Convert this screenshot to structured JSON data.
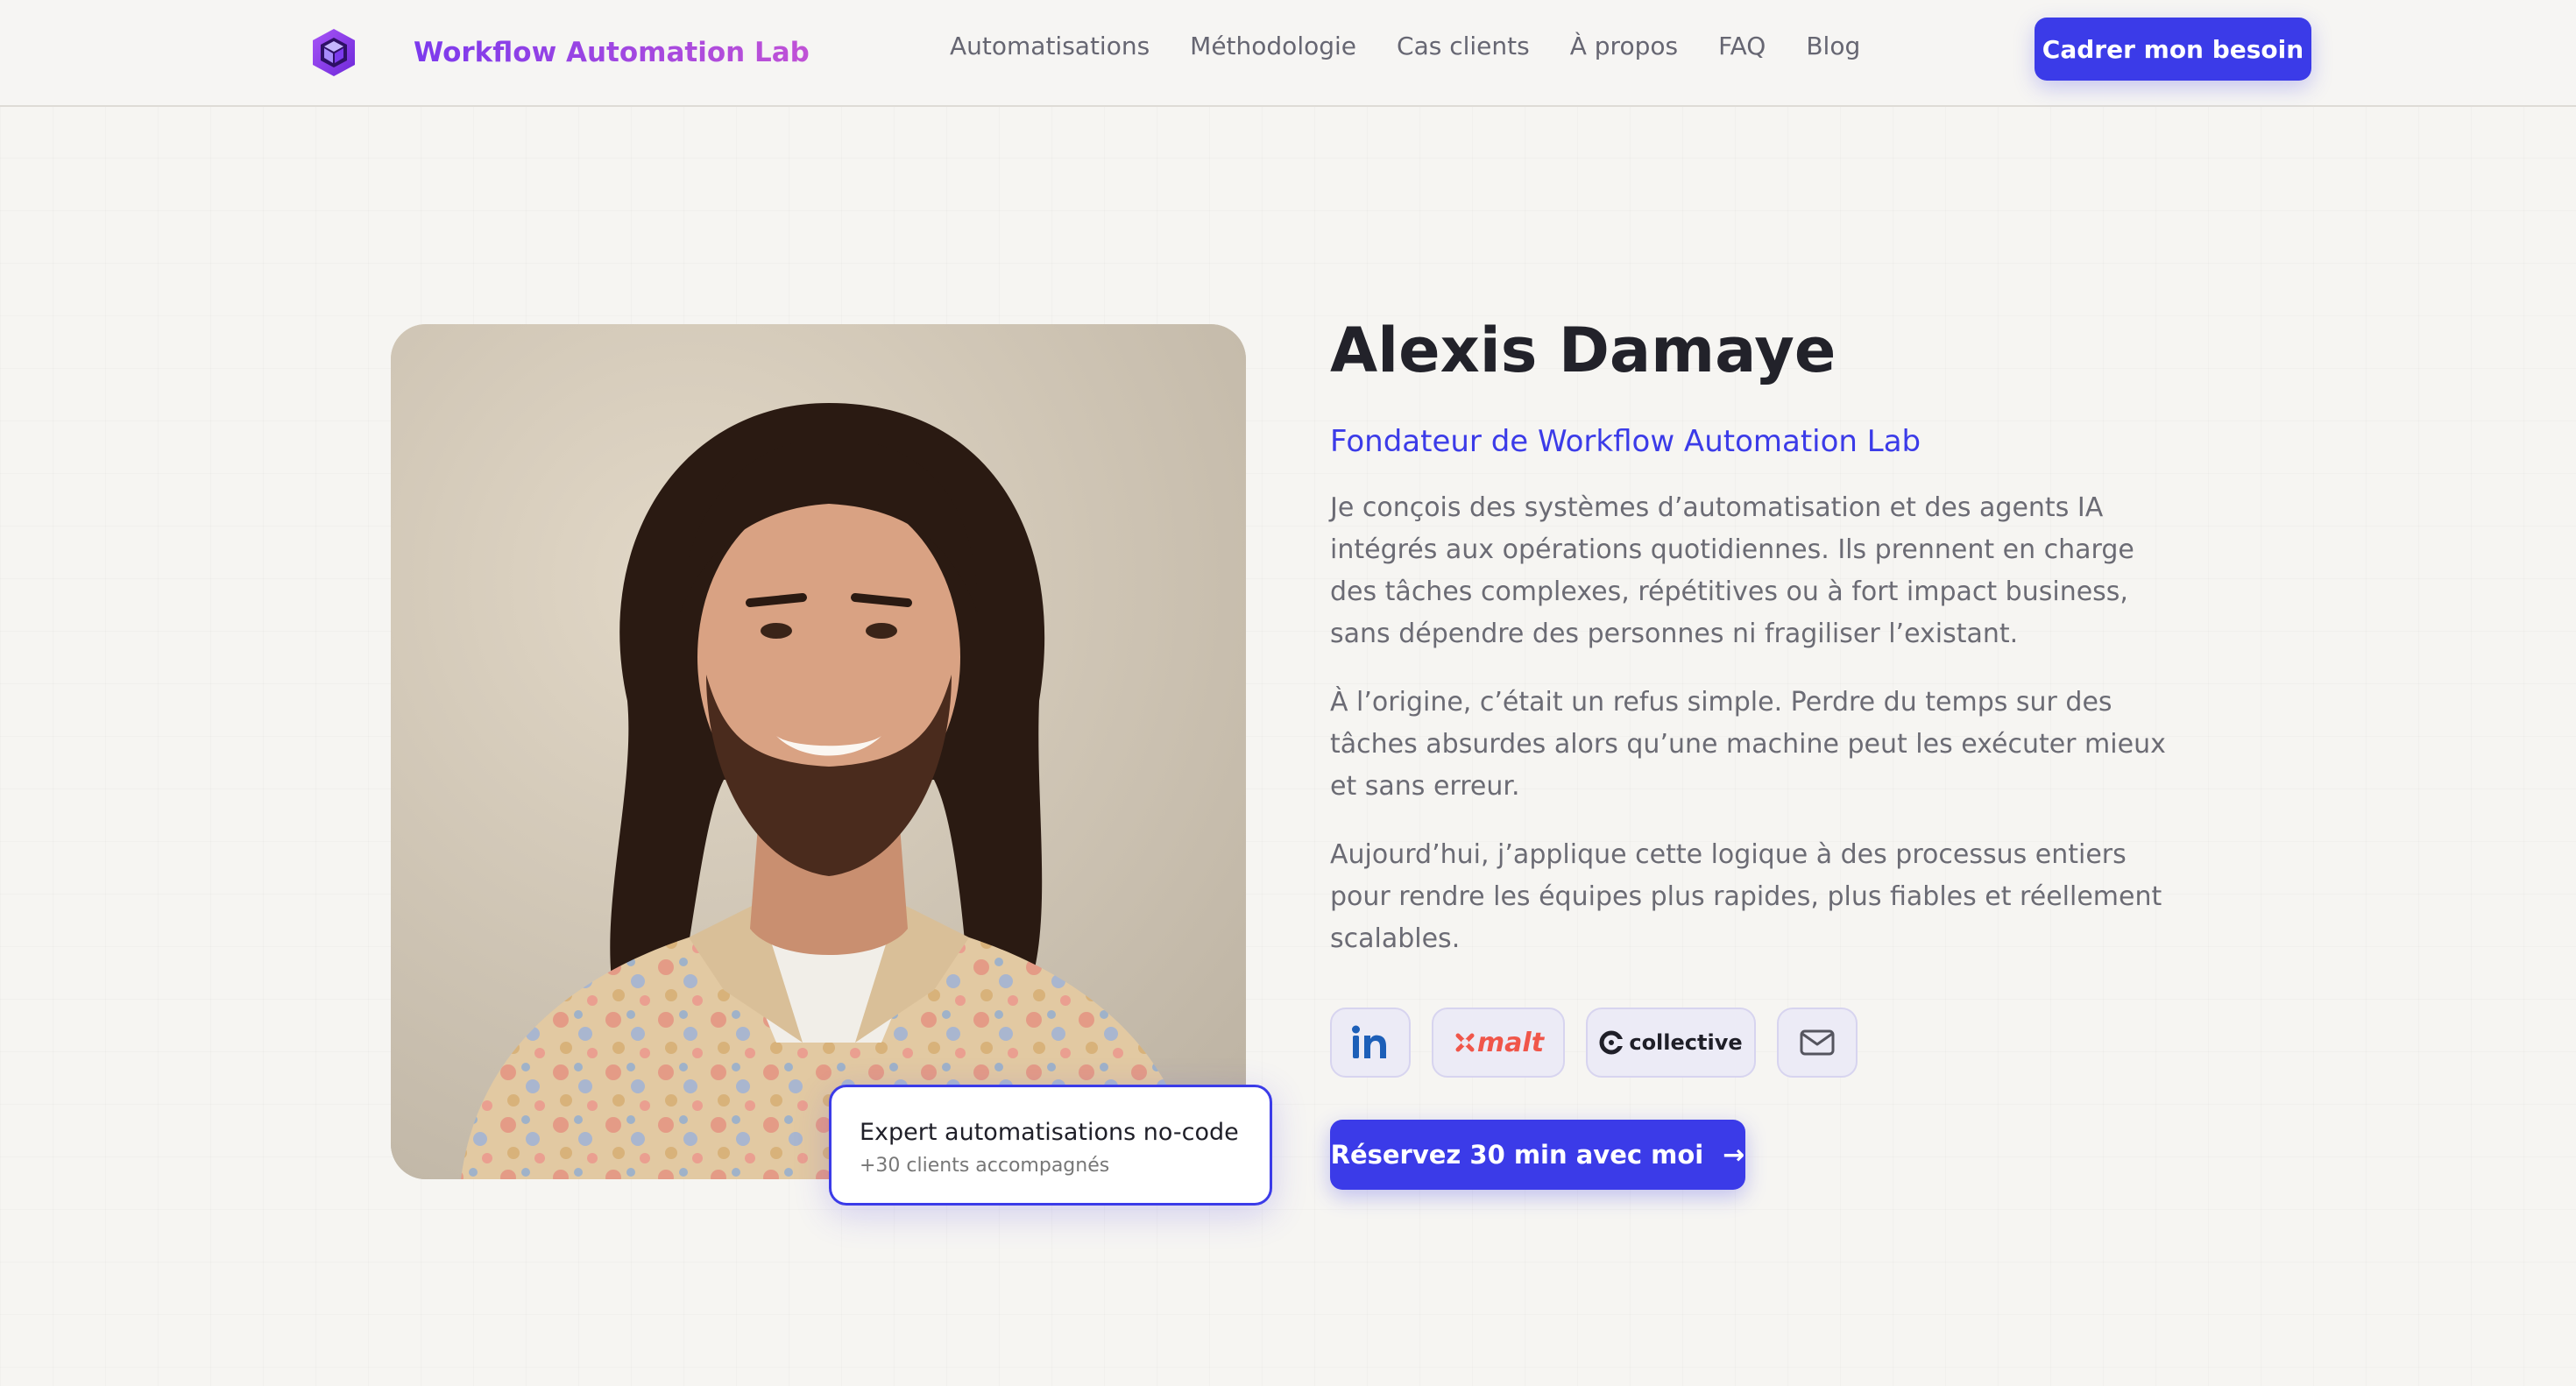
{
  "header": {
    "brand_name": "Workflow Automation Lab",
    "logo_icon": "hexagon-cube-logo-icon",
    "nav": [
      "Automatisations",
      "Méthodologie",
      "Cas clients",
      "À propos",
      "FAQ",
      "Blog"
    ],
    "cta_label": "Cadrer mon besoin"
  },
  "profile": {
    "photo": "portrait-photo",
    "name": "Alexis Damaye",
    "role": "Fondateur de Workflow Automation Lab",
    "paragraphs": [
      "Je conçois des systèmes d’automatisation et des agents IA intégrés aux opérations quotidiennes. Ils prennent en charge des tâches complexes, répétitives ou à fort impact business, sans dépendre des personnes ni fragiliser l’existant.",
      "À l’origine, c’était un refus simple. Perdre du temps sur des tâches absurdes alors qu’une machine peut les exécuter mieux et sans erreur.",
      "Aujourd’hui, j’applique cette logique à des processus entiers pour rendre les équipes plus rapides, plus fiables et réellement scalables."
    ],
    "badge": {
      "title": "Expert automatisations no-code",
      "subtitle": "+30 clients accompagnés"
    },
    "socials": [
      {
        "icon": "linkedin-icon"
      },
      {
        "icon": "malt-icon",
        "label": "malt"
      },
      {
        "icon": "collective-icon",
        "label": "collective"
      },
      {
        "icon": "mail-icon"
      }
    ],
    "cta_label": "Réservez 30 min avec moi",
    "cta_icon": "arrow-right-icon"
  },
  "colors": {
    "accent": "#3b3be8",
    "brand_gradient_start": "#7c3aed",
    "brand_gradient_end": "#c052d6",
    "background": "#f6f5f2",
    "malt": "#f0564a"
  }
}
